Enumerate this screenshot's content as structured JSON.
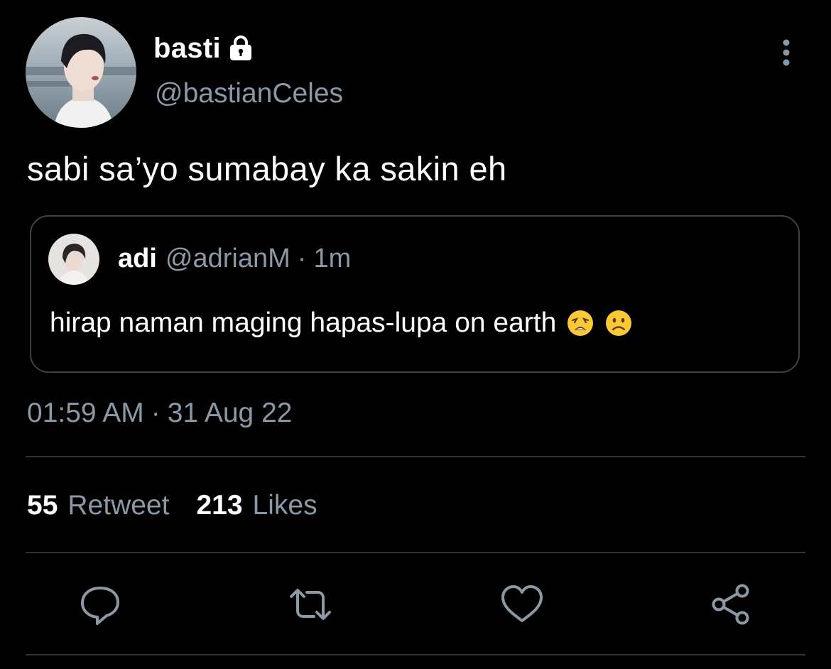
{
  "author": {
    "display_name": "basti",
    "handle": "@bastianCeles",
    "protected": true
  },
  "tweet": {
    "text": "sabi sa’yo sumabay ka sakin eh"
  },
  "quote": {
    "display_name": "adi",
    "handle": "@adrianM",
    "separator": "·",
    "time": "1m",
    "text": "hirap naman maging hapas-lupa on earth",
    "emojis": [
      "weary-face",
      "frowning-face"
    ]
  },
  "meta": {
    "time": "01:59 AM",
    "separator": "·",
    "date": "31 Aug 22"
  },
  "stats": {
    "retweets_count": "55",
    "retweets_label": "Retweet",
    "likes_count": "213",
    "likes_label": "Likes"
  },
  "actions": [
    "reply-icon",
    "retweet-icon",
    "like-icon",
    "share-icon"
  ],
  "colors": {
    "background": "#000000",
    "primary_text": "#ffffff",
    "secondary_text": "#8b98a5",
    "border": "#38444d",
    "divider": "#2f3336"
  }
}
